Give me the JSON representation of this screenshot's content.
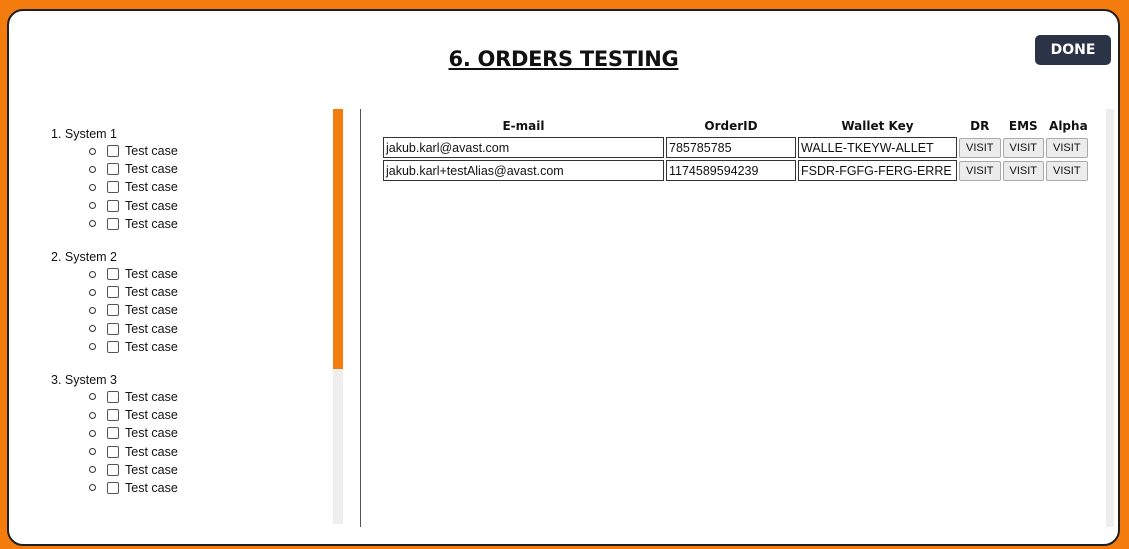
{
  "header": {
    "title": "6. ORDERS TESTING",
    "done_label": "DONE"
  },
  "colors": {
    "accent": "#f47c0f",
    "done_button": "#2b3447"
  },
  "systems": [
    {
      "title": "1. System 1",
      "cases": [
        "Test case",
        "Test case",
        "Test case",
        "Test case",
        "Test case"
      ]
    },
    {
      "title": "2. System 2",
      "cases": [
        "Test case",
        "Test case",
        "Test case",
        "Test case",
        "Test case"
      ]
    },
    {
      "title": "3. System 3",
      "cases": [
        "Test case",
        "Test case",
        "Test case",
        "Test case",
        "Test case",
        "Test case"
      ]
    }
  ],
  "table": {
    "headers": [
      "E-mail",
      "OrderID",
      "Wallet Key",
      "DR",
      "EMS",
      "Alpha"
    ],
    "rows": [
      {
        "email": "jakub.karl@avast.com",
        "order_id": "785785785",
        "wallet_key": "WALLE-TKEYW-ALLET",
        "buttons": [
          "VISIT",
          "VISIT",
          "VISIT"
        ]
      },
      {
        "email": "jakub.karl+testAlias@avast.com",
        "order_id": "1174589594239",
        "wallet_key": "FSDR-FGFG-FERG-ERRE",
        "buttons": [
          "VISIT",
          "VISIT",
          "VISIT"
        ]
      }
    ]
  }
}
